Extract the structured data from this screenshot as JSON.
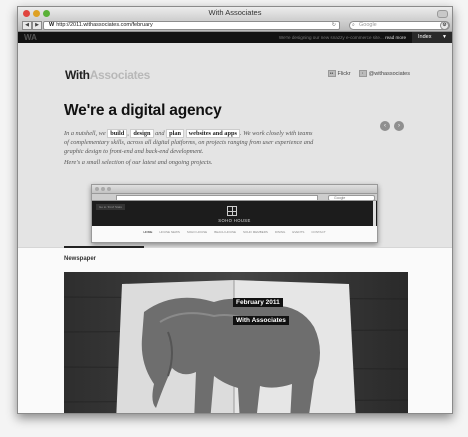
{
  "window": {
    "title": "With Associates"
  },
  "toolbar": {
    "url_prefix": "W",
    "url": "http://2011.withassociates.com/february",
    "search_placeholder": "Google"
  },
  "sitebar": {
    "logo": "WA",
    "ticker_text": "We're designing our new snazzy e-commerce site...",
    "ticker_link": "read more",
    "index_label": "Index"
  },
  "brand": {
    "with": "With",
    "associates": "Associates"
  },
  "socials": [
    {
      "label": "Flickr",
      "icon": "flickr-icon"
    },
    {
      "label": "@withassociates",
      "icon": "twitter-icon"
    }
  ],
  "hero": {
    "headline": "We're a digital agency",
    "intro_1": "In a nutshell, we",
    "tag_build": "build",
    "intro_comma": ",",
    "tag_design": "design",
    "intro_and": "and",
    "tag_plan": "plan",
    "tag_web": "websites and apps",
    "intro_2": ". We work closely with teams of complementary skills, across all digital platforms, on projects ranging from user experience and graphic design to front-end and back-end development.",
    "intro_3": "Here's a small selection of our latest and ongoing projects."
  },
  "carousel": {
    "prev": "‹",
    "next": "›"
  },
  "mini_browser": {
    "search_placeholder": "Google",
    "find_label": "Go to 'Find' Stats",
    "site_title": "SOHO HOUSE",
    "nav": [
      "HOME",
      "HOUSE NEWS",
      "SOHO HOUSE",
      "BEACH HOUSE",
      "SOHO MEMBERS",
      "DINING",
      "EVENTS",
      "CONTACT"
    ]
  },
  "section": {
    "title": "Newspaper"
  },
  "newspaper": {
    "line1": "February 2011",
    "line2": "With Associates"
  }
}
